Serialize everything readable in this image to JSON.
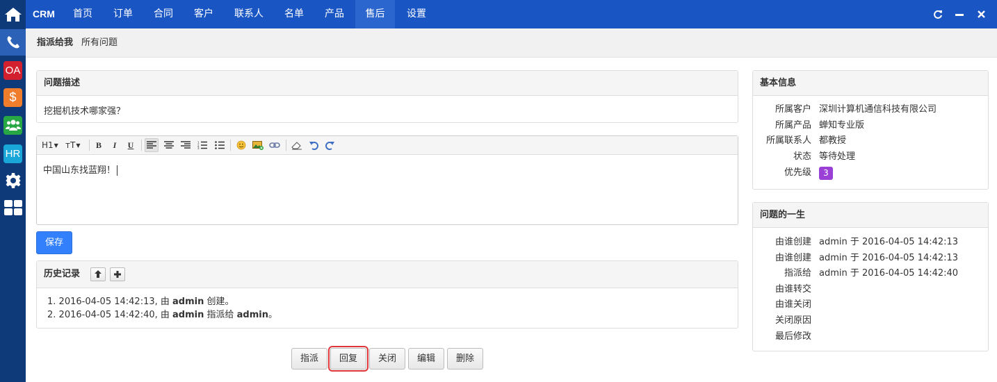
{
  "dock": {
    "oa_label": "OA",
    "hr_label": "HR",
    "money_symbol": "$"
  },
  "nav": {
    "brand": "CRM",
    "items": [
      "首页",
      "订单",
      "合同",
      "客户",
      "联系人",
      "名单",
      "产品",
      "售后",
      "设置"
    ],
    "active": "售后",
    "accent_color": "#1a55c4"
  },
  "subnav": {
    "item1": "指派给我",
    "item2": "所有问题"
  },
  "description": {
    "title": "问题描述",
    "text": "挖掘机技术哪家强？"
  },
  "editor": {
    "heading_btn": "H1",
    "fontsize_btn": "тT",
    "bold": "B",
    "italic": "I",
    "underline": "U",
    "content": "中国山东找蓝翔！"
  },
  "save_label": "保存",
  "history": {
    "title": "历史记录",
    "entries": [
      {
        "prefix": "2016-04-05 14:42:13, 由 ",
        "user": "admin",
        "suffix": " 创建。"
      },
      {
        "prefix": "2016-04-05 14:42:40, 由 ",
        "user": "admin",
        "middle": " 指派给 ",
        "user2": "admin",
        "suffix": "。"
      }
    ]
  },
  "actions": {
    "assign": "指派",
    "reply": "回复",
    "close": "关闭",
    "edit": "编辑",
    "delete": "删除"
  },
  "basic": {
    "title": "基本信息",
    "rows": [
      {
        "label": "所属客户",
        "value": "深圳计算机通信科技有限公司"
      },
      {
        "label": "所属产品",
        "value": "蝉知专业版"
      },
      {
        "label": "所属联系人",
        "value": "都教授"
      },
      {
        "label": "状态",
        "value": "等待处理"
      },
      {
        "label": "优先级",
        "value": "3"
      }
    ],
    "priority_color": "#9a40d6"
  },
  "lifecycle": {
    "title": "问题的一生",
    "rows": [
      {
        "label": "由谁创建",
        "value": "admin 于 2016-04-05 14:42:13"
      },
      {
        "label": "由谁创建",
        "value": "admin 于 2016-04-05 14:42:13"
      },
      {
        "label": "指派给",
        "value": "admin 于 2016-04-05 14:42:40"
      },
      {
        "label": "由谁转交",
        "value": ""
      },
      {
        "label": "由谁关闭",
        "value": ""
      },
      {
        "label": "关闭原因",
        "value": ""
      },
      {
        "label": "最后修改",
        "value": ""
      }
    ]
  }
}
